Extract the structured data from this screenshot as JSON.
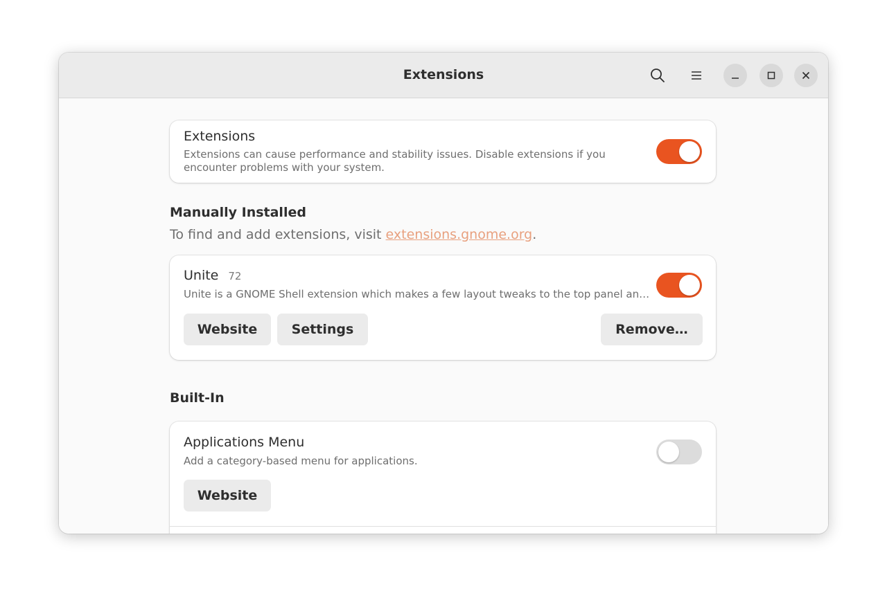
{
  "window": {
    "title": "Extensions"
  },
  "colors": {
    "accent": "#e95420",
    "link": "#e8a07e"
  },
  "icons": {
    "search": "search-icon",
    "menu": "hamburger-menu-icon",
    "minimize": "minimize-icon",
    "maximize": "maximize-icon",
    "close": "close-icon"
  },
  "master": {
    "title": "Extensions",
    "description": "Extensions can cause performance and stability issues. Disable extensions if you encounter problems with your system.",
    "enabled": true
  },
  "manual": {
    "heading": "Manually Installed",
    "desc_prefix": "To find and add extensions, visit ",
    "link_text": "extensions.gnome.org",
    "desc_suffix": ".",
    "items": [
      {
        "name": "Unite",
        "version": "72",
        "description": "Unite is a GNOME Shell extension which makes a few layout tweaks to the top panel an…",
        "enabled": true,
        "website_label": "Website",
        "settings_label": "Settings",
        "remove_label": "Remove…"
      }
    ]
  },
  "builtin": {
    "heading": "Built-In",
    "items": [
      {
        "name": "Applications Menu",
        "description": "Add a category-based menu for applications.",
        "enabled": false,
        "website_label": "Website"
      }
    ]
  }
}
